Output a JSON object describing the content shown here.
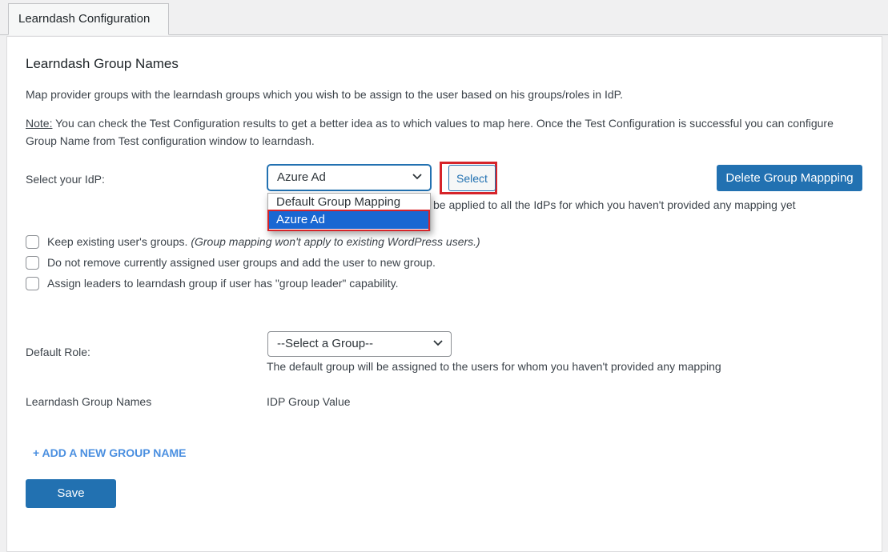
{
  "tab": {
    "label": "Learndash Configuration"
  },
  "section": {
    "title": "Learndash Group Names",
    "description": "Map provider groups with the learndash groups which you wish to be assign to the user based on his groups/roles in IdP.",
    "note_label": "Note:",
    "note_text": " You can check the Test Configuration results to get a better idea as to which values to map here. Once the Test Configuration is successful you can configure Group Name from Test configuration window to learndash."
  },
  "idp": {
    "label": "Select your IdP:",
    "selected": "Azure Ad",
    "options": [
      "Default Group Mapping",
      "Azure Ad"
    ],
    "highlighted_option": "Azure Ad",
    "select_button": "Select",
    "delete_button": "Delete Group Mappping",
    "hint_partial": "be applied to all the IdPs for which you haven't provided any mapping yet"
  },
  "checkboxes": [
    {
      "label": "Keep existing user's groups. ",
      "italic": "(Group mapping won't apply to existing WordPress users.)",
      "checked": false
    },
    {
      "label": "Do not remove currently assigned user groups and add the user to new group.",
      "italic": "",
      "checked": false
    },
    {
      "label": "Assign leaders to learndash group if user has \"group leader\" capability.",
      "italic": "",
      "checked": false
    }
  ],
  "default_role": {
    "label": "Default Role:",
    "selected": "--Select a Group--",
    "hint": "The default group will be assigned to the users for whom you haven't provided any mapping"
  },
  "mapping_table": {
    "col1": "Learndash Group Names",
    "col2": "IDP Group Value"
  },
  "add_link": "+ ADD A NEW GROUP NAME",
  "save_button": "Save",
  "colors": {
    "primary": "#2271b1",
    "highlight_border": "#d6242a",
    "dropdown_selected": "#1967d2",
    "link": "#4a8fe0"
  },
  "icons": {
    "dropdown_arrow": "chevron-down-icon"
  }
}
